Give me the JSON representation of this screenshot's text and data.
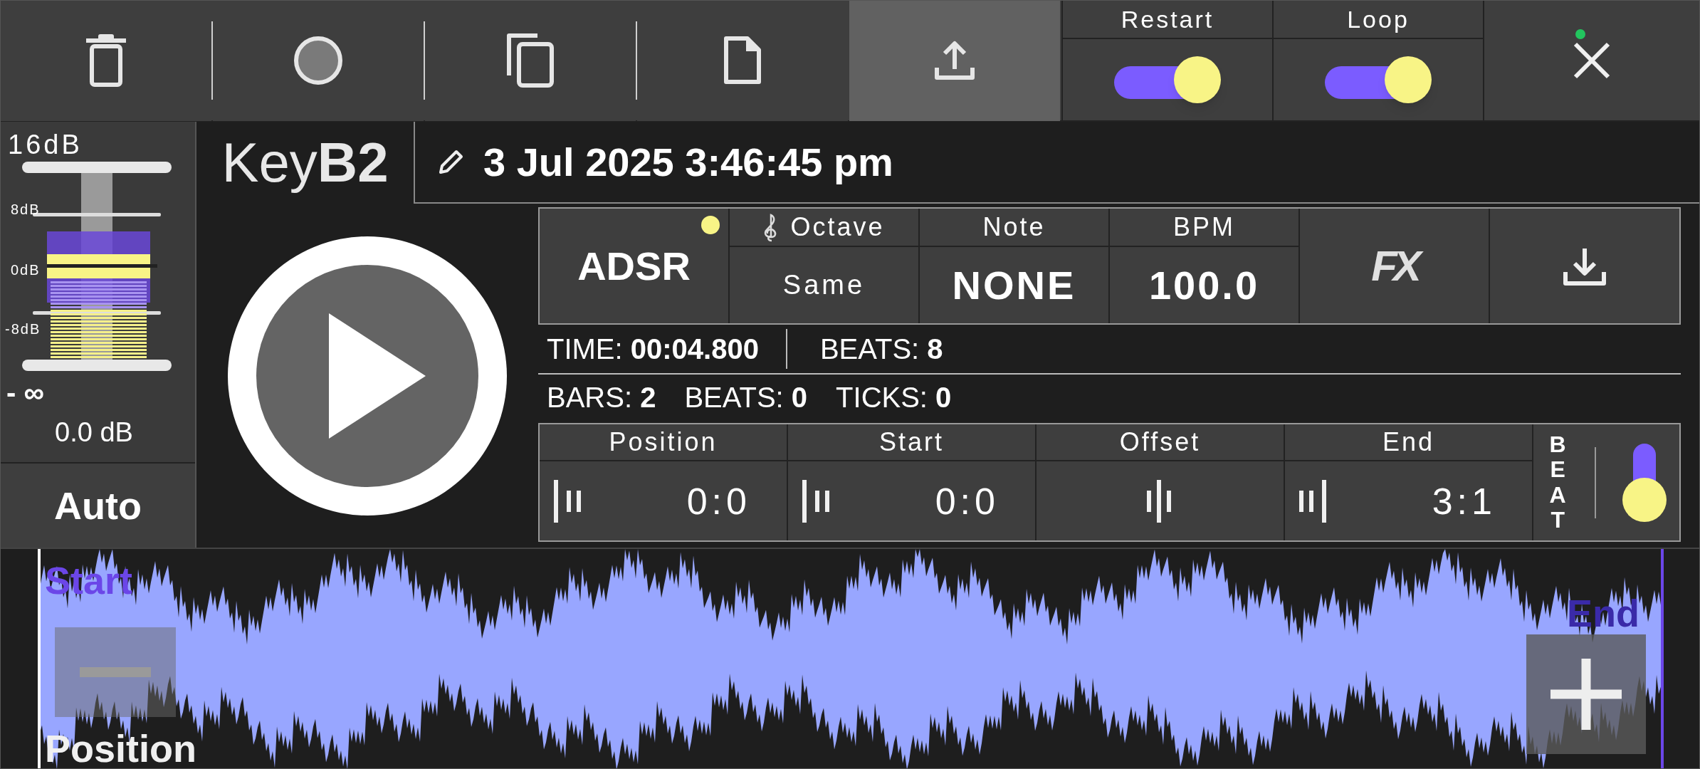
{
  "toolbar": [
    {
      "kind": "delete",
      "selected": false
    },
    {
      "kind": "record",
      "selected": false
    },
    {
      "kind": "copy",
      "selected": false
    },
    {
      "kind": "new",
      "selected": false
    },
    {
      "kind": "export",
      "selected": true
    }
  ],
  "toggles": [
    {
      "label": "Restart",
      "on": true
    },
    {
      "label": "Loop",
      "on": true
    }
  ],
  "close": {
    "status_dot": true
  },
  "meter": {
    "max_label": "16dB",
    "ticks": [
      "8dB",
      "0dB",
      "-8dB"
    ],
    "min_label": "- ∞",
    "reading": "0.0 dB"
  },
  "mode_button": {
    "label": "Auto"
  },
  "title": "Key**B2**",
  "date": "3 Jul 2025 3:46:45 pm",
  "adsr": {
    "label": "ADSR",
    "indicator": true
  },
  "params": [
    {
      "label": "Octave",
      "value": "Same",
      "kind": "octave"
    },
    {
      "label": "Note",
      "value": "NONE",
      "kind": "note"
    },
    {
      "label": "BPM",
      "value": "100.0",
      "kind": "bpm"
    }
  ],
  "fx_button": {
    "label": "FX"
  },
  "time_row": [
    "TIME: **00:04.800**",
    "BEATS: **8**"
  ],
  "bars_row": [
    "BARS: **2**",
    "BEATS: **0**",
    "TICKS: **0**"
  ],
  "markers": [
    {
      "label": "Position",
      "value": "0:0",
      "kind": "position"
    },
    {
      "label": "Start",
      "value": "0:0",
      "kind": "start"
    },
    {
      "label": "Offset",
      "kind": "offset"
    },
    {
      "label": "End",
      "value": "3:1",
      "kind": "end"
    }
  ],
  "beat": {
    "label": "BEAT",
    "on": true
  },
  "waveform": {
    "start_label": "Start",
    "end_label": "End",
    "position_label": "Position"
  }
}
